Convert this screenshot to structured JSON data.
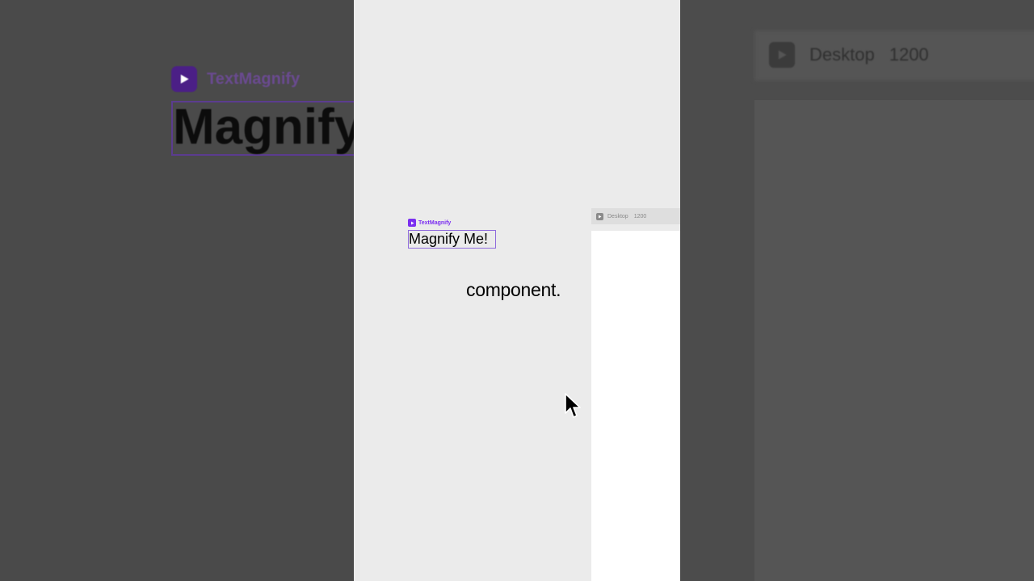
{
  "background": {
    "component_name": "TextMagnify",
    "magnify_text": "Magnify",
    "frame_name": "Desktop",
    "frame_size": "1200"
  },
  "canvas": {
    "component": {
      "name": "TextMagnify",
      "text": "Magnify Me!"
    },
    "caption": "component.",
    "frame": {
      "name": "Desktop",
      "size": "1200"
    }
  },
  "colors": {
    "accent": "#7b2ff0",
    "canvas_bg": "#ebebeb",
    "frame_bg": "#ffffff"
  },
  "icons": {
    "component": "play-icon",
    "frame": "play-icon",
    "pointer": "cursor-icon"
  }
}
